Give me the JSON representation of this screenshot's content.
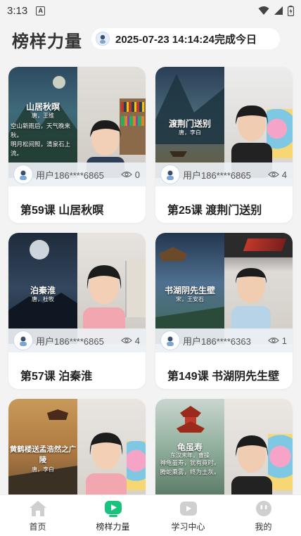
{
  "status_bar": {
    "time": "3:13",
    "notification_letter": "A"
  },
  "header": {
    "title": "榜样力量",
    "marquee_text": "2025-07-23 14:14:24完成今日"
  },
  "cards": [
    {
      "poem_title": "山居秋暝",
      "poem_author": "唐，王维",
      "poem_lines": [
        "空山新雨后，天气晚来",
        "秋。",
        "明月松间照，清泉石上",
        "流。"
      ],
      "user": "用户186****6865",
      "views": "0",
      "lesson": "第59课 山居秋暝"
    },
    {
      "poem_title": "渡荆门送别",
      "poem_author": "唐，李白",
      "poem_lines": [],
      "user": "用户186****6865",
      "views": "4",
      "lesson": "第25课 渡荆门送别"
    },
    {
      "poem_title": "泊秦淮",
      "poem_author": "唐，杜牧",
      "poem_lines": [],
      "user": "用户186****6865",
      "views": "4",
      "lesson": "第57课 泊秦淮"
    },
    {
      "poem_title": "书湖阴先生壁",
      "poem_author": "宋，王安石",
      "poem_lines": [],
      "user": "用户186****6363",
      "views": "1",
      "lesson": "第149课 书湖阴先生壁"
    },
    {
      "poem_title": "黄鹤楼送孟浩然之广陵",
      "poem_author": "唐，李白",
      "poem_lines": []
    },
    {
      "poem_title": "龟虽寿",
      "poem_author": "东汉末年，曹操",
      "poem_lines": [
        "神龟虽寿，犹有竟时。",
        "腾蛇乘雾，终为土灰。"
      ]
    }
  ],
  "tabbar": [
    {
      "label": "首页",
      "icon": "home-icon",
      "active": false
    },
    {
      "label": "榜样力量",
      "icon": "play-icon",
      "active": true
    },
    {
      "label": "学习中心",
      "icon": "study-icon",
      "active": false
    },
    {
      "label": "我的",
      "icon": "profile-icon",
      "active": false
    }
  ],
  "colors": {
    "accent": "#19c37d",
    "inactive": "#cccccc",
    "background": "#f3f3f3"
  }
}
